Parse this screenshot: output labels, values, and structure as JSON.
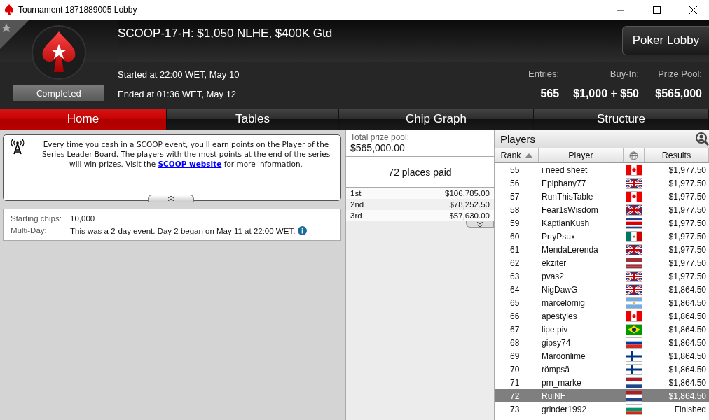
{
  "window": {
    "title": "Tournament 1871889005 Lobby"
  },
  "header": {
    "title": "SCOOP-17-H: $1,050 NLHE, $400K Gtd",
    "status": "Completed",
    "started": "Started at 22:00 WET, May 10",
    "ended": "Ended at 01:36 WET, May 12",
    "favorite": false,
    "lobby_button": "Poker Lobby",
    "stats": [
      {
        "label": "Entries:",
        "value": "565"
      },
      {
        "label": "Buy-In:",
        "value": "$1,000 + $50"
      },
      {
        "label": "Prize Pool:",
        "value": "$565,000"
      }
    ]
  },
  "tabs": [
    {
      "label": "Home",
      "selected": true
    },
    {
      "label": "Tables",
      "selected": false
    },
    {
      "label": "Chip Graph",
      "selected": false
    },
    {
      "label": "Structure",
      "selected": false
    }
  ],
  "notice": {
    "before": "Every time you cash in a SCOOP event, you'll earn points on the Player of the Series Leader Board. The players with the most points at the end of the series will win prizes. Visit the",
    "link": "SCOOP website",
    "after": "for more information."
  },
  "info": [
    {
      "label": "Starting chips:",
      "value": "10,000",
      "info_icon": false
    },
    {
      "label": "Multi-Day:",
      "value": "This was a 2-day event. Day 2 began on May 11 at 22:00 WET.",
      "info_icon": true
    }
  ],
  "prizes": {
    "total_label": "Total prize pool:",
    "total": "$565,000.00",
    "places": "72 places paid",
    "rows": [
      {
        "place": "1st",
        "amount": "$106,785.00"
      },
      {
        "place": "2nd",
        "amount": "$78,252.50"
      },
      {
        "place": "3rd",
        "amount": "$57,630.00"
      }
    ]
  },
  "players": {
    "title": "Players",
    "columns": [
      "Rank",
      "Player",
      "Results"
    ],
    "rows": [
      {
        "rank": "55",
        "player": "i need sheet",
        "kind": "ca",
        "result": "$1,977.50",
        "selected": false
      },
      {
        "rank": "56",
        "player": "Epiphany77",
        "kind": "gb",
        "result": "$1,977.50",
        "selected": false
      },
      {
        "rank": "57",
        "player": "RunThisTable",
        "kind": "ca",
        "result": "$1,977.50",
        "selected": false
      },
      {
        "rank": "58",
        "player": "Fear1sWisdom",
        "kind": "gb",
        "result": "$1,977.50",
        "selected": false
      },
      {
        "rank": "59",
        "player": "KaptianKush",
        "kind": "cr",
        "result": "$1,977.50",
        "selected": false
      },
      {
        "rank": "60",
        "player": "PrtyPsux",
        "kind": "mx",
        "result": "$1,977.50",
        "selected": false
      },
      {
        "rank": "61",
        "player": "MendaLerenda",
        "kind": "gb",
        "result": "$1,977.50",
        "selected": false
      },
      {
        "rank": "62",
        "player": "ekziter",
        "kind": "lv",
        "result": "$1,977.50",
        "selected": false
      },
      {
        "rank": "63",
        "player": "pvas2",
        "kind": "gb",
        "result": "$1,977.50",
        "selected": false
      },
      {
        "rank": "64",
        "player": "NigDawG",
        "kind": "gb",
        "result": "$1,864.50",
        "selected": false
      },
      {
        "rank": "65",
        "player": "marcelomig",
        "kind": "ar",
        "result": "$1,864.50",
        "selected": false
      },
      {
        "rank": "66",
        "player": "apestyles",
        "kind": "ca",
        "result": "$1,864.50",
        "selected": false
      },
      {
        "rank": "67",
        "player": "lipe piv",
        "kind": "br",
        "result": "$1,864.50",
        "selected": false
      },
      {
        "rank": "68",
        "player": "gipsy74",
        "kind": "ru",
        "result": "$1,864.50",
        "selected": false
      },
      {
        "rank": "69",
        "player": "Maroonlime",
        "kind": "fi",
        "result": "$1,864.50",
        "selected": false
      },
      {
        "rank": "70",
        "player": "römpsä",
        "kind": "fi",
        "result": "$1,864.50",
        "selected": false
      },
      {
        "rank": "71",
        "player": "pm_marke",
        "kind": "nl",
        "result": "$1,864.50",
        "selected": false
      },
      {
        "rank": "72",
        "player": "RuiNF",
        "kind": "nl",
        "result": "$1,864.50",
        "selected": true
      },
      {
        "rank": "73",
        "player": "grinder1992",
        "kind": "bg",
        "result": "Finished",
        "selected": false
      }
    ]
  }
}
